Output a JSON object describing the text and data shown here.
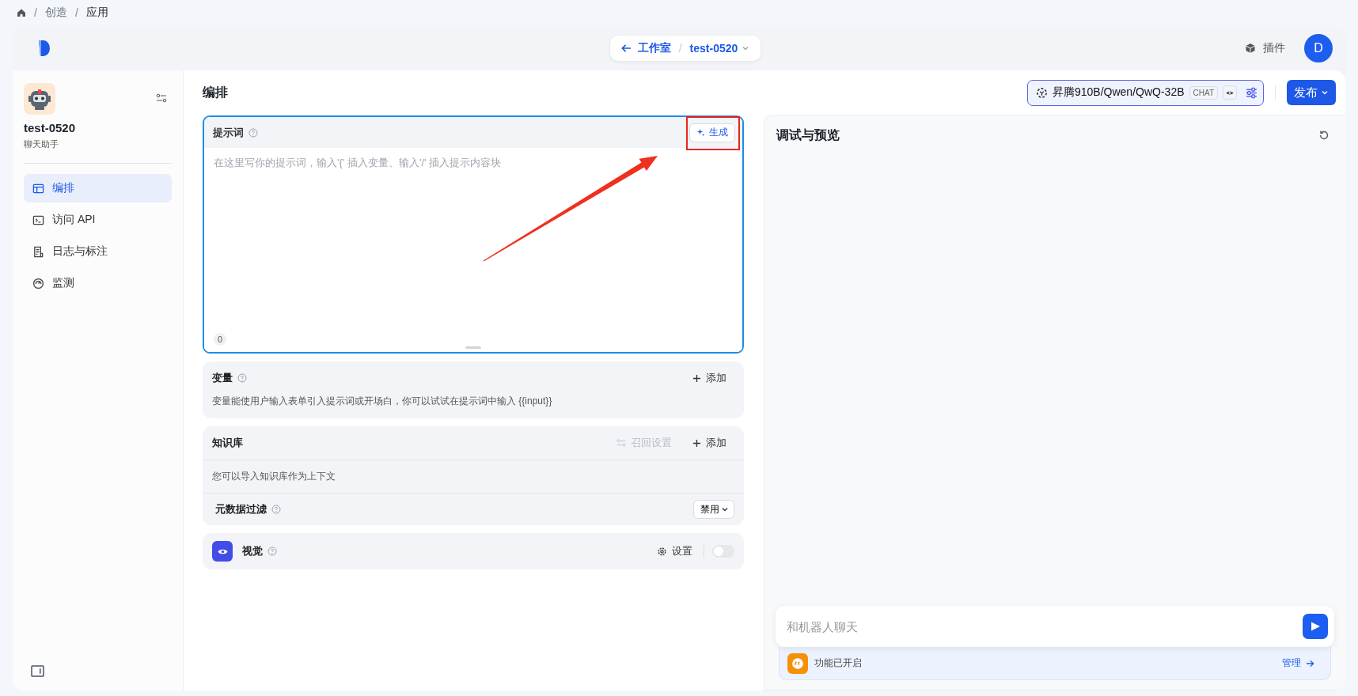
{
  "breadcrumb": [
    {
      "separator": "/",
      "label": "创造",
      "current": false
    },
    {
      "separator": "/",
      "label": "应用",
      "current": true
    }
  ],
  "header": {
    "back_label": "工作室",
    "separator": "/",
    "app_name": "test-0520",
    "plugins_label": "插件",
    "avatar_initial": "D"
  },
  "sidebar": {
    "app_name": "test-0520",
    "app_type": "聊天助手",
    "items": [
      {
        "label": "编排",
        "selected": true,
        "kind": "layout"
      },
      {
        "label": "访问 API",
        "selected": false,
        "kind": "terminal"
      },
      {
        "label": "日志与标注",
        "selected": false,
        "kind": "log"
      },
      {
        "label": "监测",
        "selected": false,
        "kind": "gauge"
      }
    ]
  },
  "page_title": "编排",
  "model": {
    "name": "昇腾910B/Qwen/QwQ-32B",
    "tag": "CHAT"
  },
  "publish_label": "发布",
  "prompt": {
    "title": "提示词",
    "generate_label": "生成",
    "placeholder": "在这里写你的提示词，输入'{' 插入变量、输入'/' 插入提示内容块",
    "count": "0"
  },
  "variables": {
    "title": "变量",
    "add_label": "添加",
    "description": "变量能使用户输入表单引入提示词或开场白，你可以试试在提示词中输入 {{input}}"
  },
  "knowledge": {
    "title": "知识库",
    "recall_label": "召回设置",
    "recall_disabled": true,
    "add_label": "添加",
    "description": "您可以导入知识库作为上下文",
    "filter_label": "元数据过滤",
    "filter_value": "禁用"
  },
  "vision": {
    "title": "视觉",
    "settings_label": "设置",
    "on": false
  },
  "preview": {
    "title": "调试与预览",
    "chat_placeholder": "和机器人聊天",
    "feature_status": "功能已开启",
    "manage_label": "管理"
  }
}
